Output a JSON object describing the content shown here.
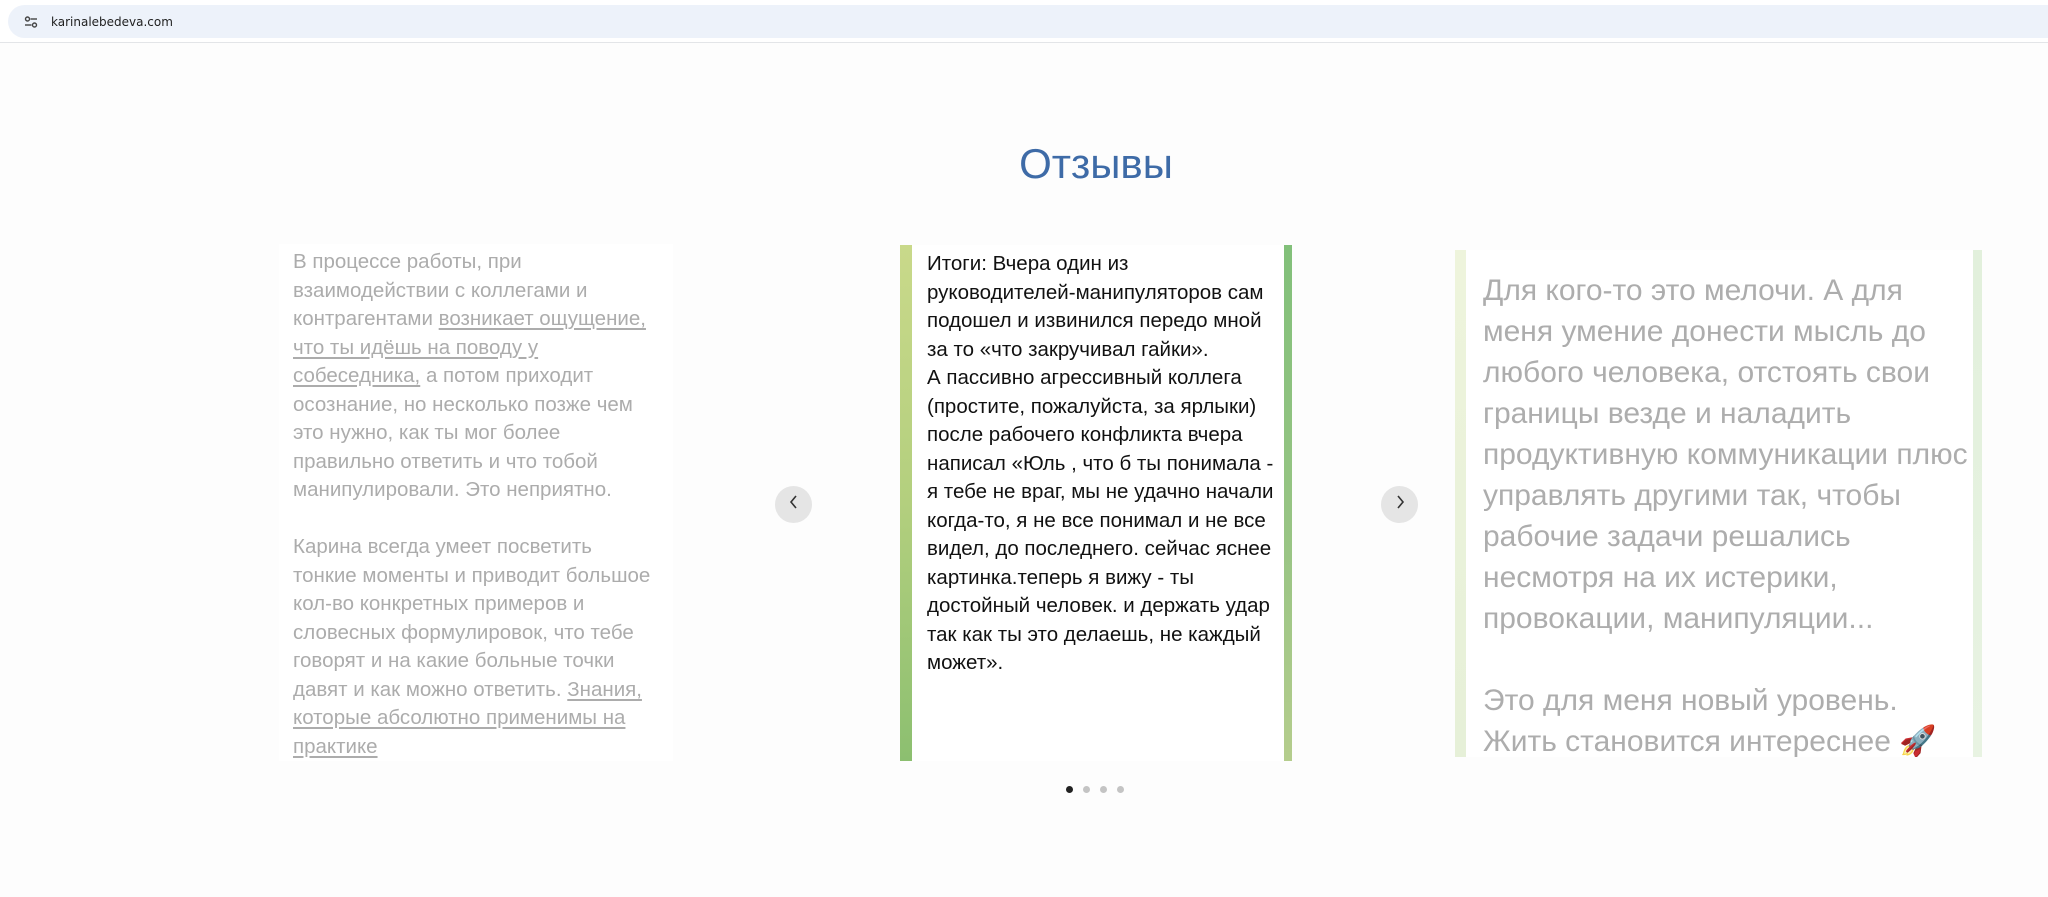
{
  "browser": {
    "url": "karinalebedeva.com"
  },
  "section": {
    "title": "Отзывы"
  },
  "reviews": [
    {
      "p1_a": "В процессе работы, при взаимодействии с коллегами и контрагентами ",
      "p1_link": "возникает ощущение, что ты идёшь на поводу у собеседника,",
      "p1_b": " а потом приходит осознание, но несколько позже чем это нужно, как ты мог более правильно ответить и что тобой манипулировали. Это неприятно.",
      "p2_a": "Карина всегда умеет посветить тонкие моменты и приводит большое кол-во конкретных примеров и словесных формулировок, что тебе говорят и на какие больные точки давят и как можно ответить. ",
      "p2_link": "Знания, которые абсолютно применимы на практике"
    },
    {
      "p1": "Итоги: Вчера один из руководителей-манипуляторов сам подошел и извинился передо мной за то «что закручивал гайки».",
      "p2": "А пассивно агрессивный коллега (простите, пожалуйста, за ярлыки) после рабочего конфликта вчера написал «Юль , что б ты понимала - я тебе не враг, мы не удачно начали когда-то, я не все понимал и не все видел, до последнего. сейчас яснее картинка.теперь я вижу - ты достойный человек. и держать удар так как ты это делаешь, не каждый может»."
    },
    {
      "p1": "Для кого-то это мелочи. А для меня умение донести мысль до любого человека, отстоять свои границы везде и наладить продуктивную коммуникации плюс управлять другими так, чтобы рабочие задачи решались несмотря на их истерики, провокации, манипуляции...",
      "p2": "Это для меня новый уровень. Жить становится интереснее 🚀"
    }
  ],
  "slider": {
    "prev_icon": "chevron-left-icon",
    "next_icon": "chevron-right-icon",
    "dots_count": 4,
    "active_dot": 0
  },
  "colors": {
    "title": "#3e6ba7",
    "text_dim": "#acacac",
    "text_active": "#111111"
  }
}
